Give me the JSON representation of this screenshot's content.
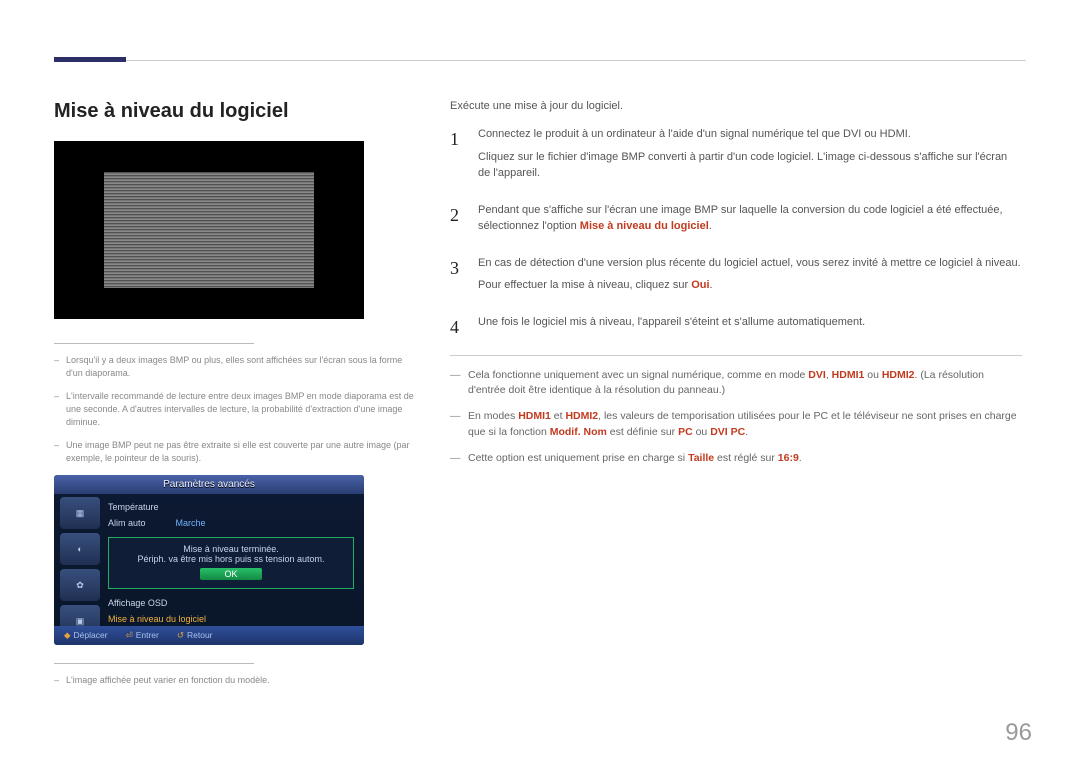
{
  "header_accent_color": "#2b2f66",
  "title": "Mise à niveau du logiciel",
  "left_notes": [
    "Lorsqu'il y a deux images BMP ou plus, elles sont affichées sur l'écran sous la forme d'un diaporama.",
    "L'intervalle recommandé de lecture entre deux images BMP en mode diaporama est de une seconde. A d'autres intervalles de lecture, la probabilité d'extraction d'une image diminue.",
    "Une image BMP peut ne pas être extraite si elle est couverte par une autre image (par exemple, le pointeur de la souris)."
  ],
  "osd": {
    "title": "Paramètres avancés",
    "rows": [
      {
        "label": "Température",
        "value": ""
      },
      {
        "label": "Alim auto",
        "value": "Marche"
      }
    ],
    "popup_line1": "Mise à niveau terminée.",
    "popup_line2": "Périph. va être mis hors puis ss tension autom.",
    "popup_ok": "OK",
    "after_rows": [
      "Affichage OSD"
    ],
    "highlight_row": "Mise à niveau du logiciel",
    "footer": {
      "move": "Déplacer",
      "enter": "Entrer",
      "return": "Retour"
    }
  },
  "model_note": "L'image affichée peut varier en fonction du modèle.",
  "intro": "Exécute une mise à jour du logiciel.",
  "steps": [
    {
      "num": "1",
      "paras": [
        {
          "segments": [
            {
              "t": "Connectez le produit à un ordinateur à l'aide d'un signal numérique tel que DVI ou HDMI."
            }
          ]
        },
        {
          "segments": [
            {
              "t": "Cliquez sur le fichier d'image BMP converti à partir d'un code logiciel. L'image ci-dessous s'affiche sur l'écran de l'appareil."
            }
          ]
        }
      ]
    },
    {
      "num": "2",
      "paras": [
        {
          "segments": [
            {
              "t": "Pendant que s'affiche sur l'écran une image BMP sur laquelle la conversion du code logiciel a été effectuée, sélectionnez l'option "
            },
            {
              "t": "Mise à niveau du logiciel",
              "em": true
            },
            {
              "t": "."
            }
          ]
        }
      ]
    },
    {
      "num": "3",
      "paras": [
        {
          "segments": [
            {
              "t": "En cas de détection d'une version plus récente du logiciel actuel, vous serez invité à mettre ce logiciel à niveau."
            }
          ]
        },
        {
          "segments": [
            {
              "t": "Pour effectuer la mise à niveau, cliquez sur "
            },
            {
              "t": "Oui",
              "em": true
            },
            {
              "t": "."
            }
          ]
        }
      ]
    },
    {
      "num": "4",
      "paras": [
        {
          "segments": [
            {
              "t": "Une fois le logiciel mis à niveau, l'appareil s'éteint et s'allume automatiquement."
            }
          ]
        }
      ]
    }
  ],
  "subnotes": [
    {
      "segments": [
        {
          "t": "Cela fonctionne uniquement avec un signal numérique, comme en mode "
        },
        {
          "t": "DVI",
          "em": true
        },
        {
          "t": ", "
        },
        {
          "t": "HDMI1",
          "em": true
        },
        {
          "t": " ou "
        },
        {
          "t": "HDMI2",
          "em": true
        },
        {
          "t": ". (La résolution d'entrée doit être identique à la résolution du panneau.)"
        }
      ]
    },
    {
      "segments": [
        {
          "t": "En modes "
        },
        {
          "t": "HDMI1",
          "em": true
        },
        {
          "t": " et "
        },
        {
          "t": "HDMI2",
          "em": true
        },
        {
          "t": ", les valeurs de temporisation utilisées pour le PC et le téléviseur ne sont prises en charge que si la fonction "
        },
        {
          "t": "Modif. Nom",
          "em": true
        },
        {
          "t": " est définie sur "
        },
        {
          "t": "PC",
          "em": true
        },
        {
          "t": " ou "
        },
        {
          "t": "DVI PC",
          "em": true
        },
        {
          "t": "."
        }
      ]
    },
    {
      "segments": [
        {
          "t": "Cette option est uniquement prise en charge si "
        },
        {
          "t": "Taille",
          "em": true
        },
        {
          "t": " est réglé sur "
        },
        {
          "t": "16:9",
          "em": true
        },
        {
          "t": "."
        }
      ]
    }
  ],
  "page_number": "96"
}
